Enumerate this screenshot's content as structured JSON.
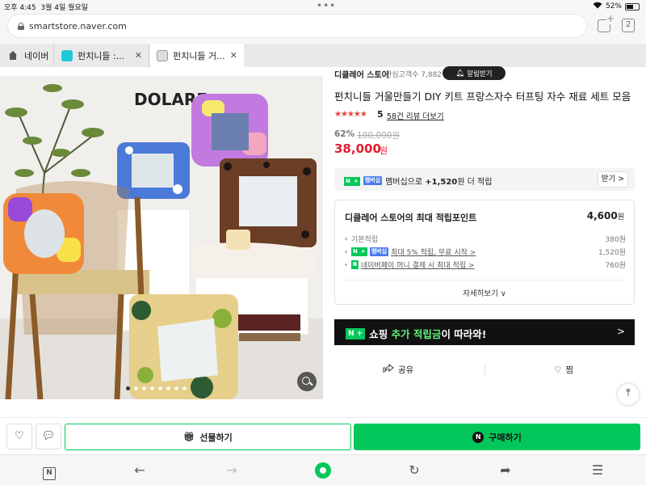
{
  "status": {
    "time": "오후 4:45",
    "date": "3월 4일 월요일",
    "dots": "•••",
    "battery": "52%"
  },
  "browser": {
    "url": "smartstore.naver.com",
    "tab_count": "2"
  },
  "tabs": [
    {
      "label": "네이버",
      "icon": "home-icon"
    },
    {
      "label": "펀치니들 :...",
      "icon": "smartstore-favicon",
      "close": "✕"
    },
    {
      "label": "펀치니들 거...",
      "icon": "store-favicon",
      "close": "✕"
    }
  ],
  "photo": {
    "brand_logo": "DOLARE",
    "slide_count": 8,
    "active_slide": 0
  },
  "store": {
    "name": "디클레어 스토어",
    "interest": "관심고객수 7,882",
    "alarm_label": "알림받기"
  },
  "product": {
    "title": "펀치니들 거울만들기 DIY 키트 프랑스자수 터프팅 자수 재료 세트 모음",
    "stars": "★★★★★",
    "rating": "5",
    "reviews": "58건 리뷰 더보기",
    "discount": "62%",
    "original_price": "100,000원",
    "price": "38,000",
    "price_unit": "원"
  },
  "membership": {
    "badge_n": "N",
    "badge_plus": "+",
    "badge_label": "멤버십",
    "text_pre": "멤버십으로 ",
    "amount": "+1,520",
    "text_post": "원 더 적립",
    "receive_label": "받기 >"
  },
  "points": {
    "title": "디클레어 스토어의 최대 적립포인트",
    "total": "4,600",
    "total_unit": "원",
    "rows": [
      {
        "label": "기본적립",
        "value": "380원"
      },
      {
        "label": "최대 5% 적립, 무료 시작 >",
        "value": "1,520원"
      },
      {
        "label": "네이버페이 머니 결제 시 최대 적립 >",
        "value": "760원"
      }
    ],
    "more_label": "자세히보기 ∨"
  },
  "promo": {
    "badge": "N +",
    "text_a": "쇼핑 ",
    "text_hl": "추가 적립금",
    "text_b": "이 따라와!",
    "arrow": ">"
  },
  "actions": {
    "share_label": "공유",
    "wish_label": "찜"
  },
  "buy_bar": {
    "gift_label": "선물하기",
    "buy_label": "구매하기",
    "buy_icon_letter": "N"
  },
  "toolbar": {
    "naver_letter": "N"
  },
  "colors": {
    "naver_green": "#03c75a",
    "price_red": "#e31a2c",
    "promo_bg": "#111111"
  }
}
